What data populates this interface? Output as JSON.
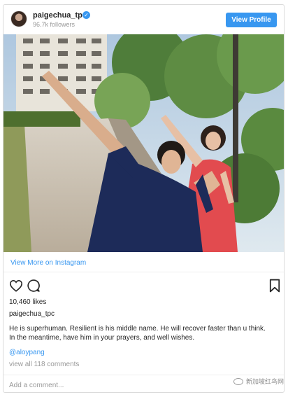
{
  "header": {
    "username": "paigechua_tpc",
    "followers": "96.7k followers",
    "view_profile_label": "View Profile",
    "verified_glyph": "✓"
  },
  "photo": {
    "description_icon": "post-image"
  },
  "view_more_label": "View More on Instagram",
  "actions": {
    "like_icon": "heart-icon",
    "comment_icon": "comment-icon",
    "save_icon": "bookmark-icon"
  },
  "likes": "10,460 likes",
  "post_username": "paigechua_tpc",
  "caption_lines": [
    "He is superhuman. Resilient is his middle name. He will recover faster than u think.",
    "In the meantime, have him in your prayers, and well wishes."
  ],
  "mention": "@aloypang",
  "view_comments": "view all 118 comments",
  "comment_placeholder": "Add a comment...",
  "watermark": "新加坡红鸟网",
  "colors": {
    "accent": "#3897f0",
    "text": "#262626",
    "muted": "#999999",
    "border": "#dbdbdb"
  }
}
